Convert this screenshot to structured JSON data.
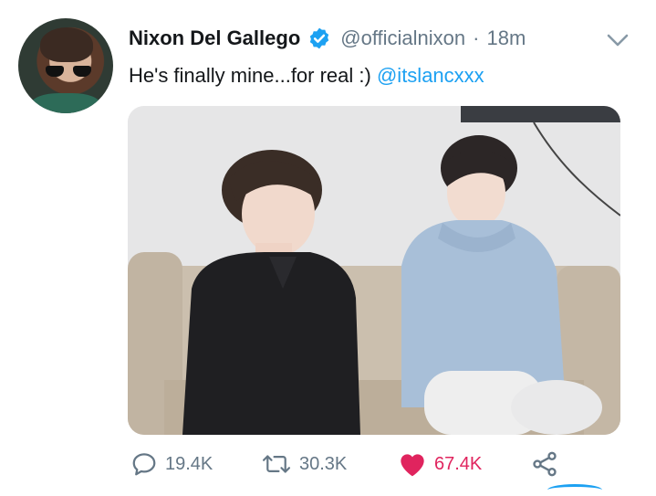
{
  "tweet": {
    "author_name": "Nixon Del Gallego",
    "handle": "@officialnixon",
    "separator": "·",
    "time": "18m",
    "text": "He's finally mine...for real :)",
    "mention": "@itslancxxx"
  },
  "actions": {
    "replies": "19.4K",
    "retweets": "30.3K",
    "likes": "67.4K"
  },
  "icons": {
    "verified": "verified-badge-icon",
    "menu": "chevron-down-icon",
    "reply": "reply-icon",
    "retweet": "retweet-icon",
    "like": "heart-icon",
    "share": "share-icon"
  },
  "colors": {
    "accent": "#1da1f2",
    "like": "#e0245e",
    "muted": "#657786",
    "text": "#14171a"
  }
}
